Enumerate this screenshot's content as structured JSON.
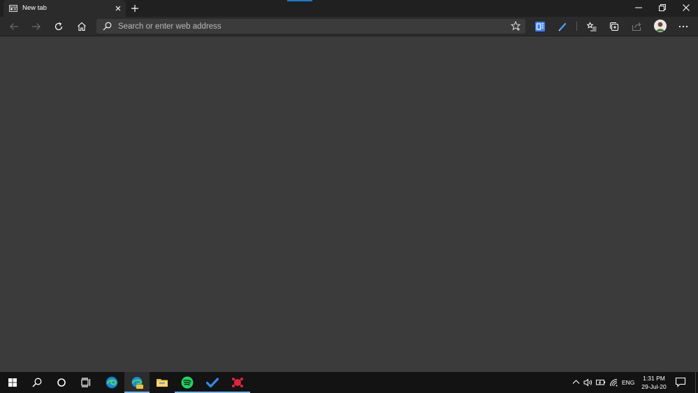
{
  "tab": {
    "title": "New tab",
    "favicon": "new-tab-page-icon"
  },
  "toolbar": {
    "search_placeholder": "Search or enter web address",
    "icons": [
      "back-icon",
      "forward-icon",
      "refresh-icon",
      "home-icon",
      "favorite-star-icon",
      "extension-icon",
      "pen-extension-icon",
      "favorites-icon",
      "collections-icon",
      "share-icon",
      "avatar",
      "more-icon"
    ]
  },
  "window_controls": [
    "minimize-icon",
    "restore-icon",
    "close-icon"
  ],
  "taskbar": {
    "apps": [
      "windows-start-icon",
      "search-icon",
      "cortana-icon",
      "task-view-icon",
      "edge-icon",
      "edge-canary-icon",
      "file-explorer-icon",
      "spotify-icon",
      "todo-icon",
      "app-icon"
    ],
    "language": "ENG",
    "time": "1:31 PM",
    "date": "29-Jul-20"
  },
  "colors": {
    "tab_strip": "#202020",
    "toolbar": "#2b2b2b",
    "page_background": "#3b3b3b",
    "taskbar": "#131313",
    "accent": "#76b9ed"
  }
}
